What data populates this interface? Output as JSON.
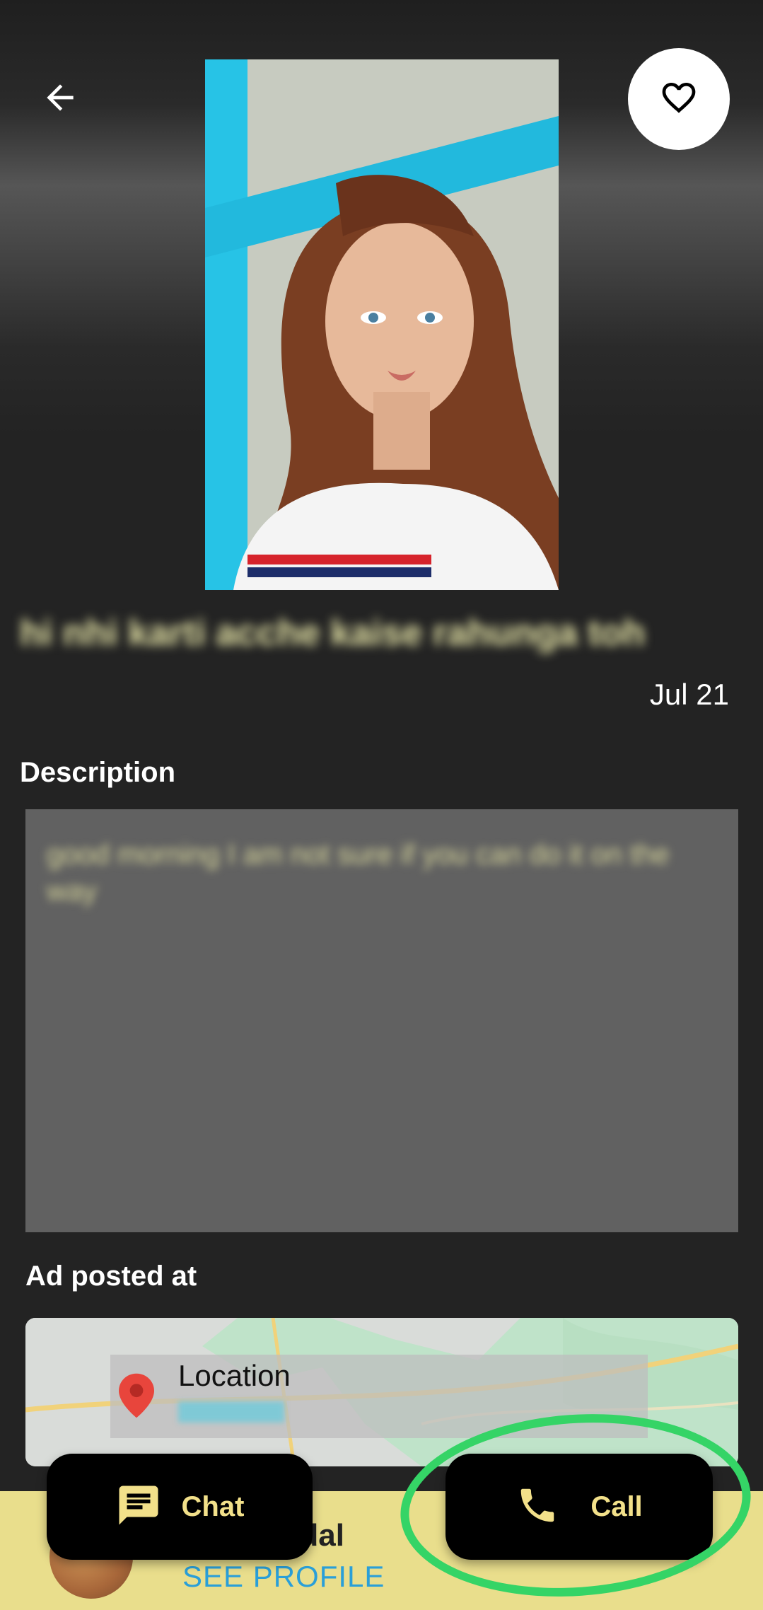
{
  "header": {
    "back_icon": "arrow-left-icon",
    "favorite_icon": "heart-outline-icon"
  },
  "ad": {
    "title": "hi nhi karti acche kaise rahunga toh",
    "date": "Jul 21",
    "description_heading": "Description",
    "description": "good morning I am not sure if you can do it on the way",
    "posted_at_heading": "Ad posted at"
  },
  "map": {
    "pin_icon": "map-pin-icon",
    "location_title": "Location"
  },
  "seller": {
    "name_visible": "andal",
    "see_profile": "SEE PROFILE"
  },
  "actions": {
    "chat_label": "Chat",
    "chat_icon": "chat-bubble-icon",
    "call_label": "Call",
    "call_icon": "phone-icon"
  },
  "colors": {
    "background": "#232323",
    "accent_yellow": "#f2e08a",
    "footer": "#e9de8c",
    "link_blue": "#2a9fd8",
    "highlight_ring": "#35d466"
  }
}
